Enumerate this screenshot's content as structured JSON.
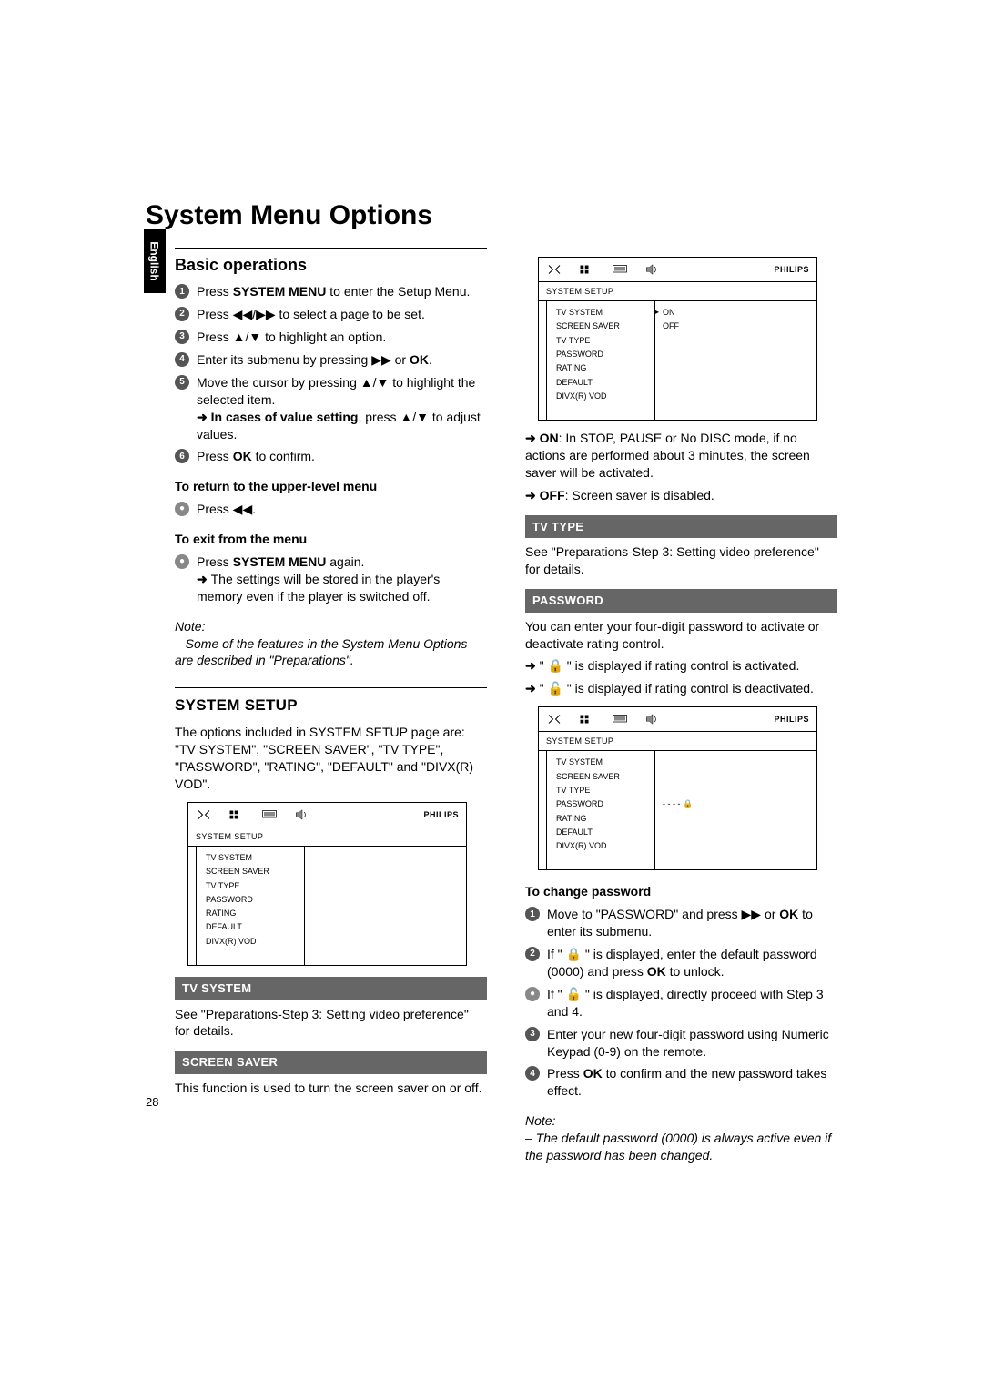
{
  "page": {
    "title": "System Menu Options",
    "language_tab": "English",
    "page_number": "28"
  },
  "basic": {
    "heading": "Basic operations",
    "s1a": "Press ",
    "s1b": "SYSTEM MENU",
    "s1c": " to enter the Setup Menu.",
    "s2": "Press ◀◀/▶▶ to select a page to be set.",
    "s3": "Press ▲/▼ to highlight an option.",
    "s4a": "Enter its submenu by pressing ▶▶ or ",
    "s4b": "OK",
    "s4c": ".",
    "s5": "Move the cursor by pressing ▲/▼ to highlight the selected item.",
    "s5arrow_a": "In cases of value setting",
    "s5arrow_b": ", press ▲/▼ to adjust values.",
    "s6a": "Press ",
    "s6b": "OK",
    "s6c": " to confirm.",
    "return_h": "To return to the upper-level menu",
    "return_b": "Press ◀◀.",
    "exit_h": "To exit from the menu",
    "exit_b1a": "Press ",
    "exit_b1b": "SYSTEM MENU",
    "exit_b1c": " again.",
    "exit_arrow": "The settings will be stored in the player's memory even if the player is switched off.",
    "note_lbl": "Note:",
    "note_body": "– Some of the features in the System Menu Options are described in \"Preparations\"."
  },
  "system_setup": {
    "heading": "SYSTEM SETUP",
    "para": "The options included in SYSTEM SETUP page are: \"TV SYSTEM\", \"SCREEN SAVER\", \"TV TYPE\", \"PASSWORD\", \"RATING\", \"DEFAULT\" and \"DIVX(R) VOD\"."
  },
  "osd_common": {
    "brand": "PHILIPS",
    "tab": "SYSTEM SETUP",
    "items": [
      "TV SYSTEM",
      "SCREEN SAVER",
      "TV TYPE",
      "PASSWORD",
      "RATING",
      "DEFAULT",
      "DIVX(R) VOD"
    ],
    "ss_on": "ON",
    "ss_off": "OFF",
    "pw_mask": "- - - -  🔒"
  },
  "tv_system": {
    "band": "TV SYSTEM",
    "para": "See \"Preparations-Step 3: Setting video preference\" for details."
  },
  "screen_saver": {
    "band": "SCREEN SAVER",
    "para": "This function is used to turn the screen saver on or off.",
    "on_a": "ON",
    "on_b": ": In STOP, PAUSE or No DISC mode, if no actions are performed about 3 minutes, the screen saver will be activated.",
    "off_a": "OFF",
    "off_b": ": Screen saver is disabled."
  },
  "tv_type": {
    "band": "TV TYPE",
    "para": "See \"Preparations-Step 3: Setting video preference\" for details."
  },
  "password": {
    "band": "PASSWORD",
    "para": "You can enter your four-digit password to activate or deactivate rating control.",
    "arr1": "\" 🔒 \" is displayed if rating control is activated.",
    "arr2": "\" 🔓 \" is displayed if rating control is deactivated.",
    "change_h": "To change password",
    "c1a": "Move to \"PASSWORD\" and press ▶▶ or ",
    "c1b": "OK",
    "c1c": " to enter its submenu.",
    "c2a": "If \" 🔒 \" is displayed, enter the default password (0000) and press ",
    "c2b": "OK",
    "c2c": " to unlock.",
    "c2alt": "If \" 🔓 \" is displayed, directly proceed with Step 3 and 4.",
    "c3": "Enter your new four-digit password using Numeric Keypad (0-9) on the remote.",
    "c4a": "Press ",
    "c4b": "OK",
    "c4c": " to confirm and the new password takes effect.",
    "note_lbl": "Note:",
    "note_body": "– The default password (0000) is always active even if the password has been changed."
  }
}
